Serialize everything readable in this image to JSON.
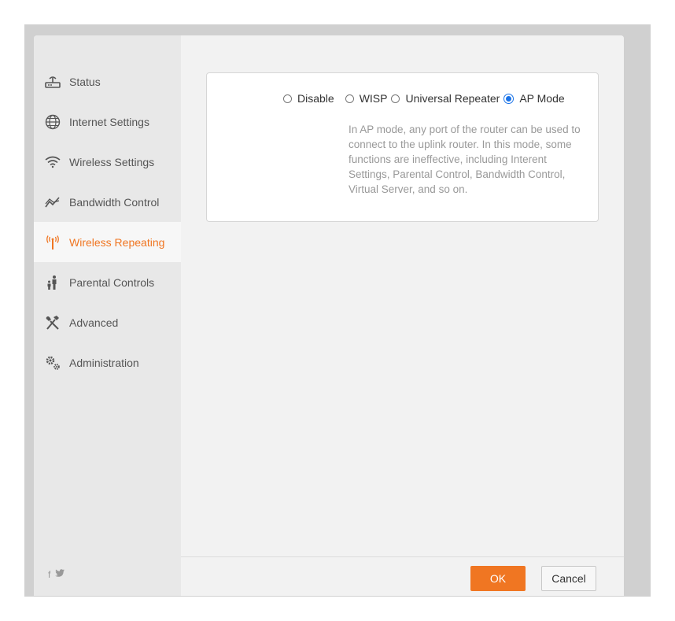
{
  "sidebar": {
    "items": [
      {
        "label": "Status",
        "icon": "router-icon"
      },
      {
        "label": "Internet Settings",
        "icon": "globe-icon"
      },
      {
        "label": "Wireless Settings",
        "icon": "wifi-icon"
      },
      {
        "label": "Bandwidth Control",
        "icon": "bandwidth-icon"
      },
      {
        "label": "Wireless Repeating",
        "icon": "antenna-icon",
        "active": true
      },
      {
        "label": "Parental Controls",
        "icon": "parent-child-icon"
      },
      {
        "label": "Advanced",
        "icon": "tools-icon"
      },
      {
        "label": "Administration",
        "icon": "gears-icon"
      }
    ],
    "social": {
      "facebook": "f",
      "twitter": "🐦"
    }
  },
  "mode": {
    "options": [
      {
        "label": "Disable",
        "checked": false
      },
      {
        "label": "WISP",
        "checked": false
      },
      {
        "label": "Universal Repeater",
        "checked": false
      },
      {
        "label": "AP Mode",
        "checked": true
      }
    ],
    "description": "In AP mode, any port of the router can be used to connect to the uplink router. In this mode, some functions are ineffective, including Interent Settings, Parental Control, Bandwidth Control, Virtual Server, and so on."
  },
  "footer": {
    "ok_label": "OK",
    "cancel_label": "Cancel"
  },
  "colors": {
    "accent": "#f07622",
    "radio_checked": "#1a73e8",
    "sidebar_bg": "#e8e8e8",
    "main_bg": "#f2f2f2"
  }
}
